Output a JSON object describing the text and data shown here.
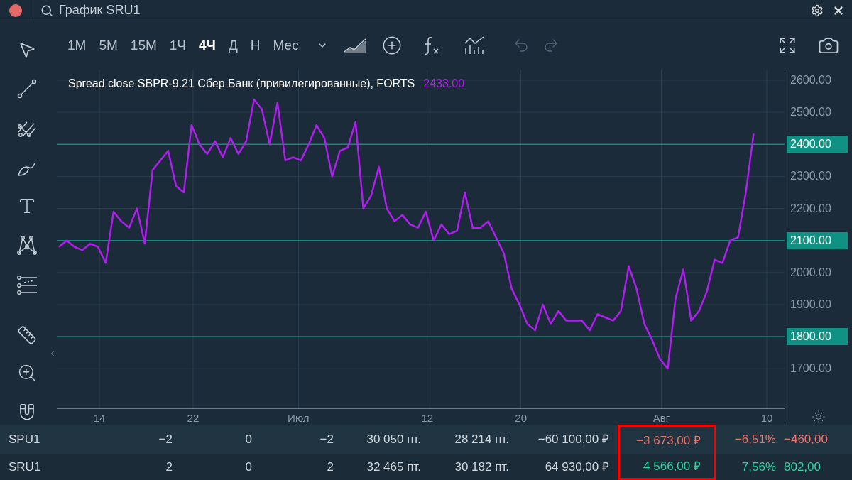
{
  "window": {
    "title": "График SRU1"
  },
  "toolbar": {
    "timeframes": [
      {
        "label": "1M",
        "selected": false
      },
      {
        "label": "5M",
        "selected": false
      },
      {
        "label": "15M",
        "selected": false
      },
      {
        "label": "1Ч",
        "selected": false
      },
      {
        "label": "4Ч",
        "selected": true
      },
      {
        "label": "Д",
        "selected": false
      },
      {
        "label": "Н",
        "selected": false
      },
      {
        "label": "Мес",
        "selected": false
      }
    ]
  },
  "chart": {
    "legend": {
      "text": "Spread close SBPR-9.21 Сбер Банк (привилегированные), FORTS",
      "value": "2433.00"
    },
    "chart_data": {
      "type": "line",
      "x": [
        "--06-10 13:00",
        "--06-11 05:00",
        "--06-11 21:00",
        "--06-12 13:00",
        "--06-13 05:00",
        "--06-13 21:00",
        "--06-14 13:00",
        "--06-15 05:00",
        "--06-15 21:00",
        "--06-16 13:00",
        "--06-17 05:00",
        "--06-17 21:00",
        "--06-18 13:00",
        "--06-19 05:00",
        "--06-19 21:00",
        "--06-20 13:00",
        "--06-21 05:00",
        "--06-21 21:00",
        "--06-22 13:00",
        "--06-23 05:00",
        "--06-23 21:00",
        "--06-24 13:00",
        "--06-25 05:00",
        "--06-25 21:00",
        "--06-26 13:00",
        "--06-27 05:00",
        "--06-27 21:00",
        "--06-28 13:00",
        "--06-29 05:00",
        "--06-29 21:00",
        "--06-30 13:00",
        "--07-01 05:00",
        "--07-01 21:00",
        "--07-02 13:00",
        "--07-03 05:00",
        "--07-03 21:00",
        "--07-04 13:00",
        "--07-05 05:00",
        "--07-05 21:00",
        "--07-06 13:00",
        "--07-07 05:00",
        "--07-07 21:00",
        "--07-08 13:00",
        "--07-09 05:00",
        "--07-09 21:00",
        "--07-10 13:00",
        "--07-11 05:00",
        "--07-11 21:00",
        "--07-12 13:00",
        "--07-13 05:00",
        "--07-13 21:00",
        "--07-14 13:00",
        "--07-15 05:00",
        "--07-15 21:00",
        "--07-16 13:00",
        "--07-17 05:00",
        "--07-17 21:00",
        "--07-18 13:00",
        "--07-19 05:00",
        "--07-19 21:00",
        "--07-20 13:00",
        "--07-21 05:00",
        "--07-21 21:00",
        "--07-22 13:00",
        "--07-23 05:00",
        "--07-23 21:00",
        "--07-24 13:00",
        "--07-25 05:00",
        "--07-25 21:00",
        "--07-26 13:00",
        "--07-27 05:00",
        "--07-27 21:00",
        "--07-28 13:00",
        "--07-29 05:00",
        "--07-29 21:00",
        "--07-30 13:00",
        "--07-31 05:00",
        "--07-31 21:00",
        "--08-01 13:00",
        "--08-02 05:00",
        "--08-02 21:00",
        "--08-03 13:00",
        "--08-04 05:00",
        "--08-04 21:00",
        "--08-05 13:00",
        "--08-06 05:00",
        "--08-06 21:00",
        "--08-07 13:00",
        "--08-08 05:00",
        "--08-08 21:00"
      ],
      "series": [
        {
          "color": "#b01ff0",
          "values": [
            2080,
            2100,
            2080,
            2070,
            2090,
            2080,
            2030,
            2190,
            2160,
            2140,
            2200,
            2090,
            2320,
            2350,
            2380,
            2270,
            2250,
            2460,
            2400,
            2370,
            2410,
            2360,
            2420,
            2370,
            2410,
            2540,
            2510,
            2400,
            2530,
            2350,
            2360,
            2350,
            2400,
            2460,
            2420,
            2300,
            2380,
            2390,
            2470,
            2200,
            2240,
            2330,
            2200,
            2160,
            2180,
            2150,
            2140,
            2190,
            2100,
            2150,
            2120,
            2130,
            2250,
            2140,
            2140,
            2160,
            2110,
            2060,
            1950,
            1900,
            1840,
            1820,
            1900,
            1840,
            1880,
            1850,
            1850,
            1850,
            1820,
            1870,
            1860,
            1850,
            1880,
            2020,
            1950,
            1840,
            1790,
            1730,
            1700,
            1920,
            2010,
            1850,
            1880,
            1940,
            2040,
            2030,
            2100,
            2110,
            2250,
            2433
          ]
        }
      ],
      "xlim": [
        "--06-10 08:40",
        "--08-11 12:23"
      ],
      "ylim": [
        1576.5,
        2633.3
      ],
      "xticks": [
        {
          "value": "--06-14",
          "label": "14"
        },
        {
          "value": "--06-22",
          "label": "22"
        },
        {
          "value": "--07-01",
          "label": "Июл"
        },
        {
          "value": "--07-12",
          "label": "12"
        },
        {
          "value": "--07-20",
          "label": "20"
        },
        {
          "value": "--08-01",
          "label": "Авг"
        },
        {
          "value": "--08-10",
          "label": "10"
        }
      ],
      "yticks": [
        {
          "value": 2600,
          "label": "2600.00"
        },
        {
          "value": 2500,
          "label": "2500.00"
        },
        {
          "value": 2400,
          "label": "2400.00"
        },
        {
          "value": 2300,
          "label": "2300.00"
        },
        {
          "value": 2200,
          "label": "2200.00"
        },
        {
          "value": 2100,
          "label": "2100.00"
        },
        {
          "value": 2000,
          "label": "2000.00"
        },
        {
          "value": 1900,
          "label": "1900.00"
        },
        {
          "value": 1800,
          "label": "1800.00"
        },
        {
          "value": 1700,
          "label": "1700.00"
        }
      ],
      "grid": true
    },
    "y_axis_labels": [
      {
        "highlighted": false
      },
      {
        "highlighted": false
      },
      {
        "highlighted": true
      },
      {
        "highlighted": false
      },
      {
        "highlighted": false
      },
      {
        "highlighted": true
      },
      {
        "highlighted": false
      },
      {
        "highlighted": false
      },
      {
        "highlighted": true
      },
      {
        "highlighted": false
      }
    ]
  },
  "table": {
    "rows": [
      {
        "negative": true,
        "cells": [
          {
            "text": "SPU1",
            "outlined": false
          },
          {
            "text": "−2",
            "outlined": false
          },
          {
            "text": "0",
            "outlined": false
          },
          {
            "text": "−2",
            "outlined": false
          },
          {
            "text": "30 050 пт.",
            "outlined": false
          },
          {
            "text": "28 214 пт.",
            "outlined": false
          },
          {
            "text": "−60 100,00 ₽",
            "outlined": false
          },
          {
            "text": "−3 673,00 ₽",
            "outlined": true
          },
          {
            "text": "−6,51%",
            "outlined": false
          },
          {
            "text": "−460,00",
            "outlined": false
          }
        ]
      },
      {
        "negative": false,
        "cells": [
          {
            "text": "SRU1",
            "outlined": false
          },
          {
            "text": "2",
            "outlined": false
          },
          {
            "text": "0",
            "outlined": false
          },
          {
            "text": "2",
            "outlined": false
          },
          {
            "text": "32 465 пт.",
            "outlined": false
          },
          {
            "text": "30 182 пт.",
            "outlined": false
          },
          {
            "text": "64 930,00 ₽",
            "outlined": false
          },
          {
            "text": "4 566,00 ₽",
            "outlined": true
          },
          {
            "text": "7,56%",
            "outlined": false
          },
          {
            "text": "802,00",
            "outlined": false
          }
        ]
      }
    ]
  }
}
